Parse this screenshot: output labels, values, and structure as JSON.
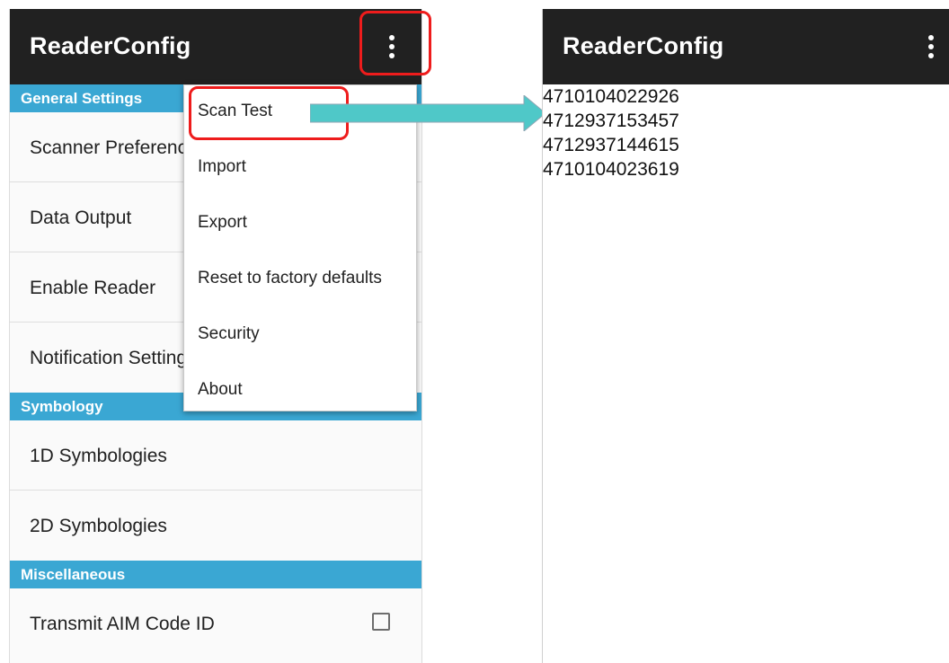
{
  "left_screen": {
    "app_title": "ReaderConfig",
    "menu_icon": "overflow-menu-icon",
    "sections": [
      {
        "title": "General Settings",
        "items": [
          "Scanner Preferences",
          "Data Output",
          "Enable Reader",
          "Notification Settings"
        ]
      },
      {
        "title": "Symbology",
        "items": [
          "1D Symbologies",
          "2D Symbologies"
        ]
      },
      {
        "title": "Miscellaneous",
        "items": [
          "Transmit AIM Code ID"
        ]
      }
    ],
    "transmit_aim_checked": false
  },
  "popup_menu": {
    "items": [
      "Scan Test",
      "Import",
      "Export",
      "Reset to factory defaults",
      "Security",
      "About"
    ]
  },
  "right_screen": {
    "app_title": "ReaderConfig",
    "menu_icon": "overflow-menu-icon",
    "scan_results": [
      "4710104022926",
      "4712937153457",
      "4712937144615",
      "4710104023619"
    ]
  },
  "colors": {
    "appbar": "#212121",
    "section_header": "#3aa7d3",
    "highlight": "#ee1c1c",
    "arrow": "#4fc8c8"
  }
}
